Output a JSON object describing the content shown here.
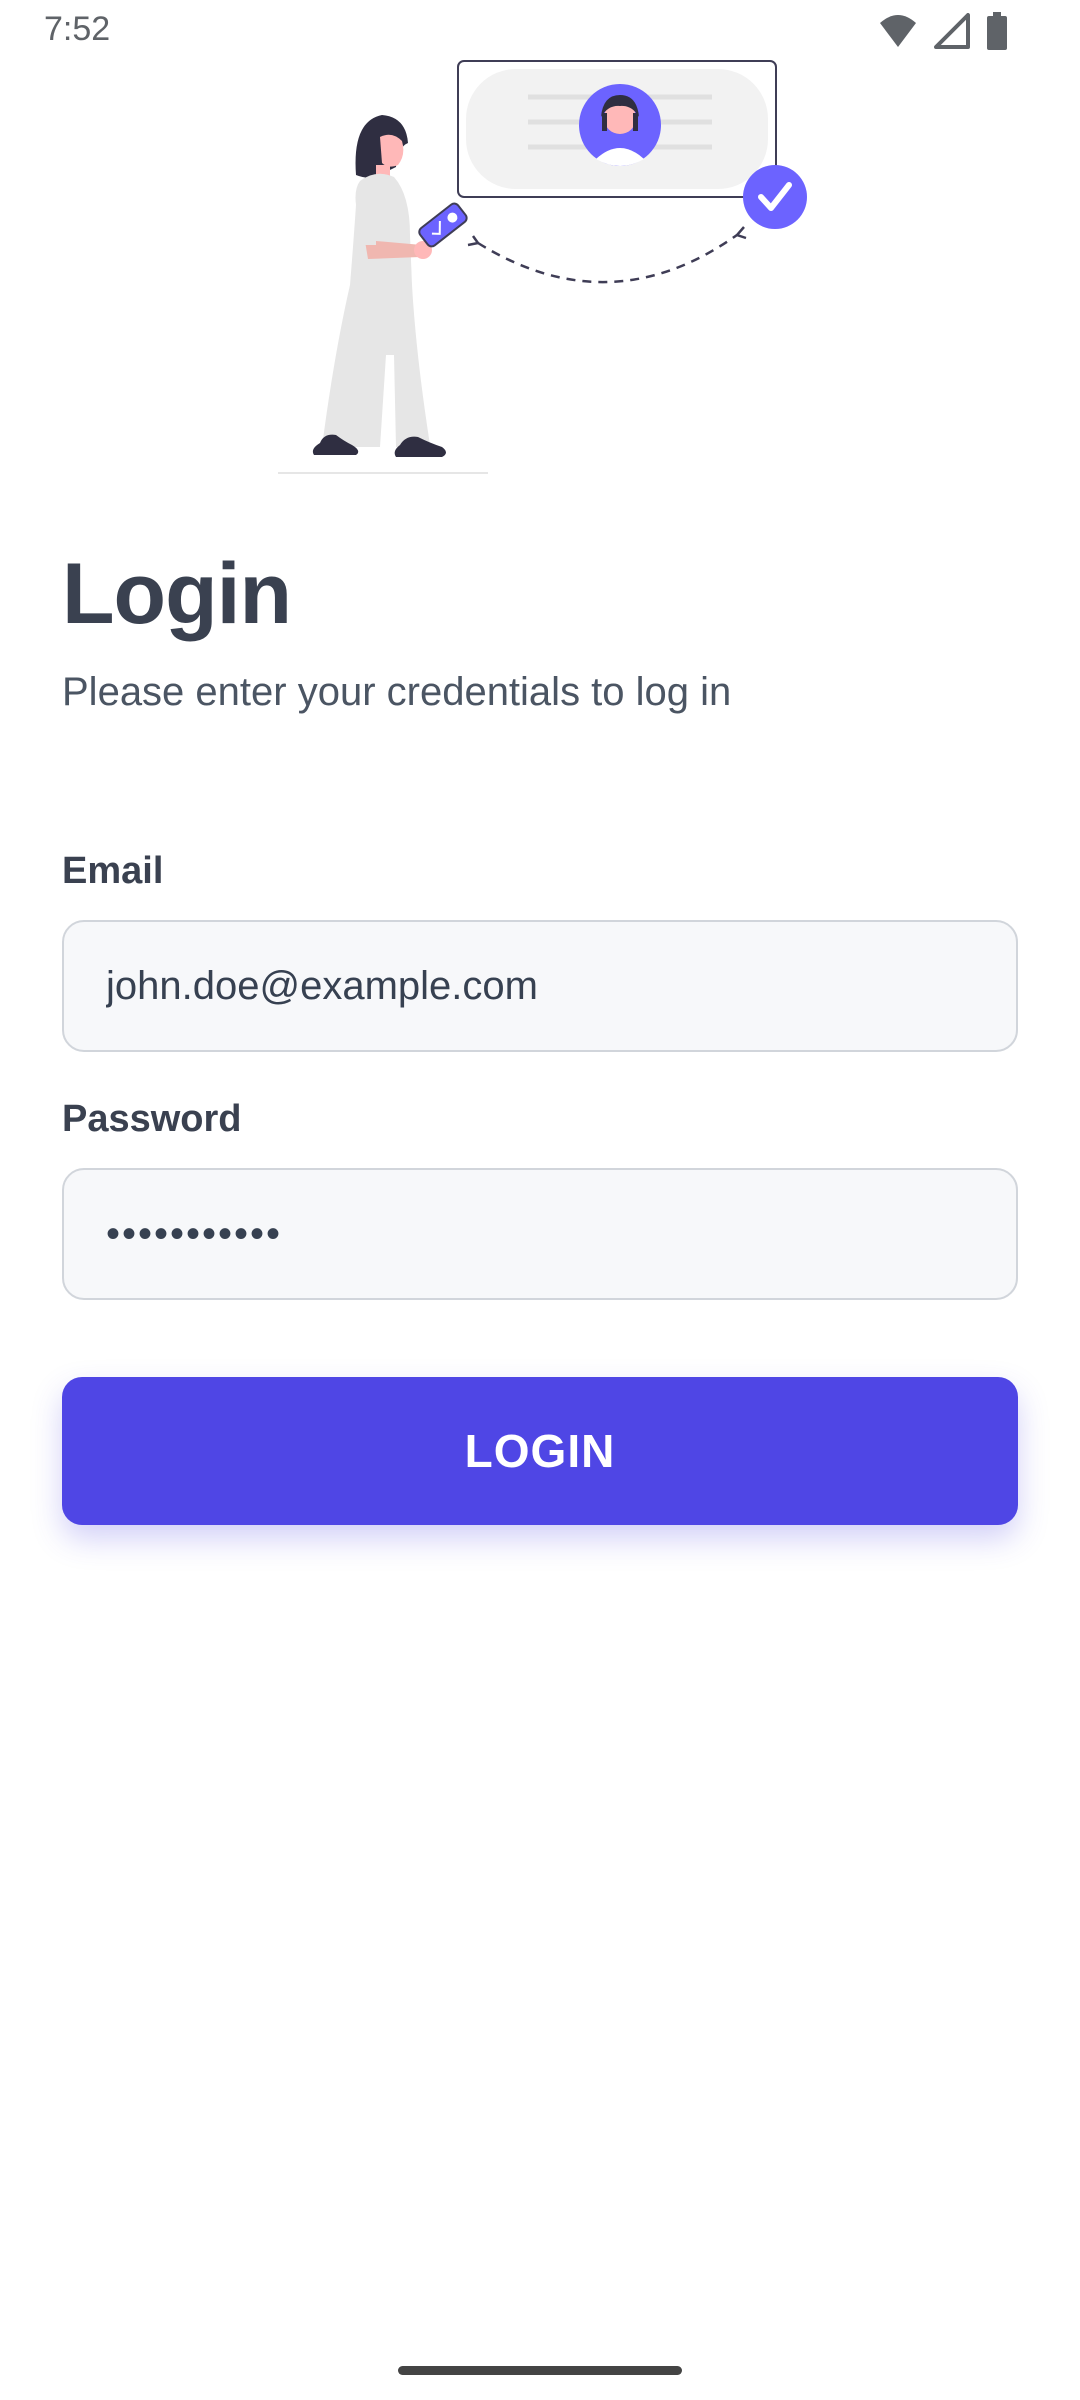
{
  "status_bar": {
    "time": "7:52",
    "icons": [
      "wifi-icon",
      "signal-icon",
      "battery-icon"
    ]
  },
  "illustration": {
    "description_icon": "verified-profile-illustration"
  },
  "header": {
    "title": "Login",
    "subtitle": "Please enter your credentials to log in"
  },
  "form": {
    "email_label": "Email",
    "email_value": "john.doe@example.com",
    "password_label": "Password",
    "password_value": "•••••••••••",
    "submit_label": "LOGIN"
  },
  "colors": {
    "accent": "#4f46e5",
    "illustration_accent": "#6c63ff",
    "title": "#3a4150",
    "input_bg": "#f7f8fa",
    "input_border": "#d1d5db"
  }
}
